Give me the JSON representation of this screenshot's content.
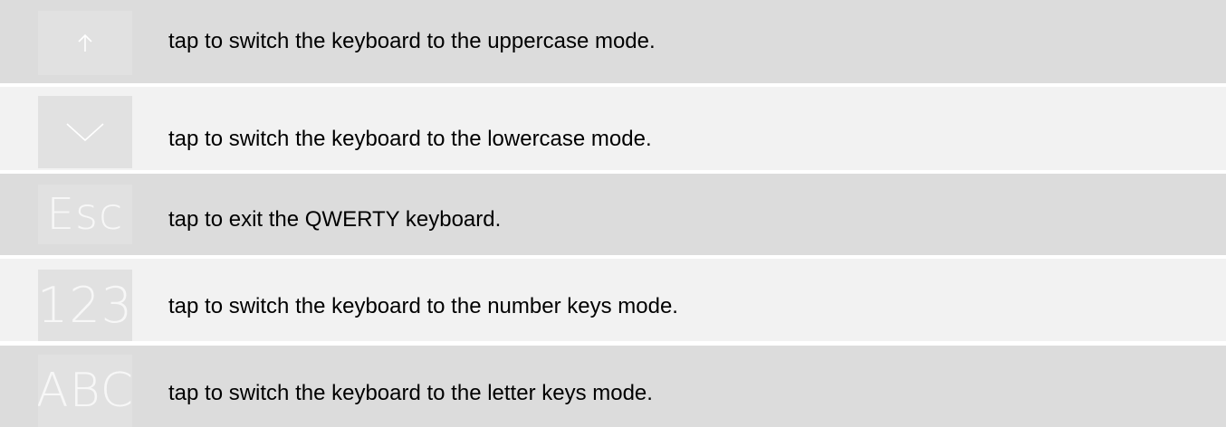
{
  "rows": [
    {
      "key_icon": "arrow-up-icon",
      "description": "tap to switch the keyboard to the uppercase mode."
    },
    {
      "key_icon": "chevron-down-icon",
      "description": "tap to switch the keyboard to the lowercase mode."
    },
    {
      "key_label": "Esc",
      "description": "tap to exit the QWERTY keyboard."
    },
    {
      "key_label": "123",
      "description": "tap to switch the keyboard to the number keys mode."
    },
    {
      "key_label": "ABC",
      "description": "tap to switch the keyboard to the letter keys mode."
    }
  ],
  "colors": {
    "row_dark": "#dcdcdc",
    "row_light": "#f2f2f2",
    "key_background": "#e1e1e1",
    "key_glyph": "#ffffff",
    "text": "#000000"
  }
}
